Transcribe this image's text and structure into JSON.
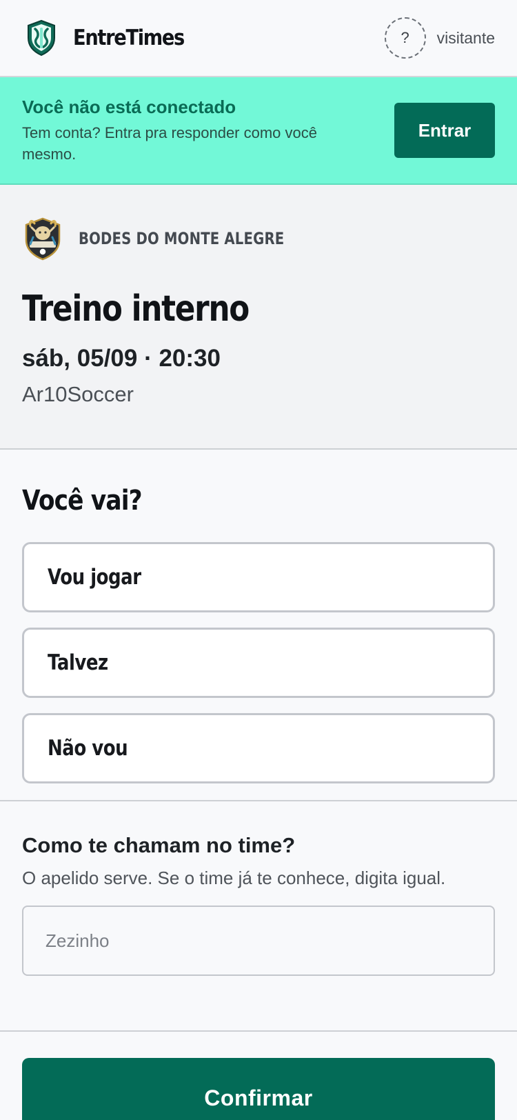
{
  "header": {
    "brand": "EntreTimes",
    "user_avatar_glyph": "?",
    "user_name": "visitante"
  },
  "banner": {
    "title": "Você não está conectado",
    "subtitle": "Tem conta? Entra pra responder como você mesmo.",
    "login_label": "Entrar"
  },
  "event": {
    "team_name": "BODES DO MONTE ALEGRE",
    "title": "Treino interno",
    "datetime": "sáb, 05/09 · 20:30",
    "location": "Ar10Soccer"
  },
  "rsvp": {
    "title": "Você vai?",
    "options": [
      {
        "label": "Vou jogar"
      },
      {
        "label": "Talvez"
      },
      {
        "label": "Não vou"
      }
    ]
  },
  "nickname": {
    "title": "Como te chamam no time?",
    "help": "O apelido serve. Se o time já te conhece, digita igual.",
    "placeholder": "Zezinho",
    "value": ""
  },
  "confirm": {
    "label": "Confirmar"
  },
  "colors": {
    "brand": "#036b57",
    "banner_bg": "#72f8d7",
    "banner_title": "#0a6b55"
  },
  "icons": {
    "logo": "shield-logo-icon",
    "team_crest": "team-crest-icon"
  }
}
